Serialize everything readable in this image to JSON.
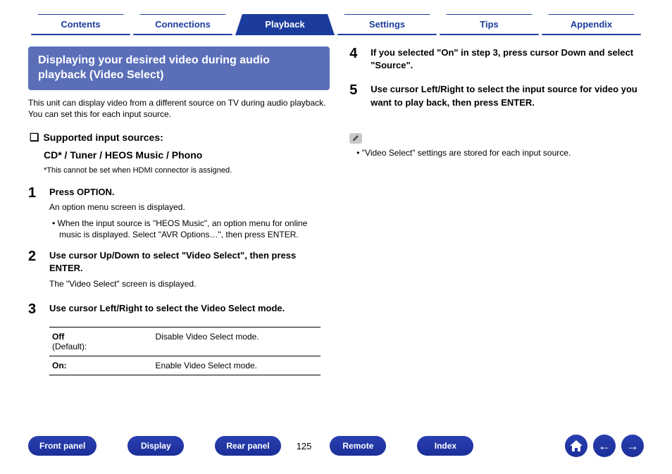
{
  "tabs": [
    {
      "label": "Contents",
      "active": false
    },
    {
      "label": "Connections",
      "active": false
    },
    {
      "label": "Playback",
      "active": true
    },
    {
      "label": "Settings",
      "active": false
    },
    {
      "label": "Tips",
      "active": false
    },
    {
      "label": "Appendix",
      "active": false
    }
  ],
  "section_title": "Displaying your desired video during audio playback (Video Select)",
  "lead": "This unit can display video from a different source on TV during audio playback. You can set this for each input source.",
  "supported": {
    "head": "Supported input sources:",
    "sub": "CD* / Tuner / HEOS Music / Phono",
    "footnote_prefix": "*",
    "footnote": "This cannot be set when HDMI connector is assigned."
  },
  "steps": [
    {
      "num": "1",
      "title": "Press OPTION.",
      "desc": "An option menu screen is displayed.",
      "bullet": "When the input source is \"HEOS Music\", an option menu for online music is displayed. Select \"AVR Options…\", then press ENTER."
    },
    {
      "num": "2",
      "title": "Use cursor Up/Down to select \"Video Select\", then press ENTER.",
      "desc": "The \"Video Select\" screen is displayed."
    },
    {
      "num": "3",
      "title": "Use cursor Left/Right to select the Video Select mode."
    },
    {
      "num": "4",
      "title": "If you selected \"On\" in step 3, press cursor Down and select \"Source\"."
    },
    {
      "num": "5",
      "title": "Use cursor Left/Right to select the input source for video you want to play back, then press ENTER."
    }
  ],
  "options_table": [
    {
      "key": "Off",
      "sub": "(Default):",
      "desc": "Disable Video Select mode."
    },
    {
      "key": "On:",
      "sub": "",
      "desc": "Enable Video Select mode."
    }
  ],
  "note": "\"Video Select\" settings are stored for each input source.",
  "bottom": {
    "buttons": [
      "Front panel",
      "Display",
      "Rear panel"
    ],
    "page": "125",
    "buttons2": [
      "Remote",
      "Index"
    ]
  }
}
